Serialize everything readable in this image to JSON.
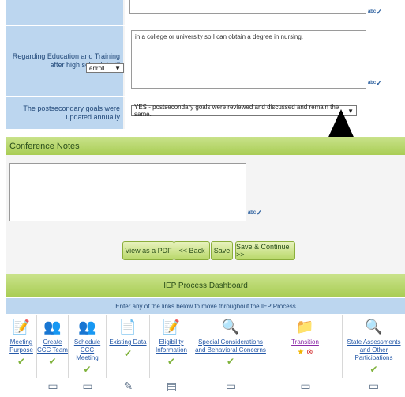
{
  "top_textarea": {
    "value": ""
  },
  "education": {
    "label": "Regarding Education and Training after high school, I will",
    "select_value": "enroll",
    "textarea_value": "in a college or university so I can obtain a degree in nursing."
  },
  "postsecondary": {
    "label": "The postsecondary goals were updated annually",
    "select_value": "YES - postsecondary goals were reviewed and discussed and remain the same."
  },
  "conference_notes": {
    "title": "Conference Notes",
    "value": ""
  },
  "buttons": {
    "pdf": "View as a PDF",
    "back": "<< Back",
    "save": "Save",
    "save_continue": "Save & Continue >>"
  },
  "dashboard": {
    "title": "IEP Process Dashboard",
    "subtitle": "Enter any of the links below to move throughout the IEP Process",
    "tiles": [
      {
        "label": "Meeting Purpose",
        "icon": "document-edit-icon",
        "status": "check"
      },
      {
        "label": "Create CCC Team",
        "icon": "team-icon",
        "status": "check"
      },
      {
        "label": "Schedule CCC Meeting",
        "icon": "team-icon",
        "status": "check"
      },
      {
        "label": "Existing Data",
        "icon": "data-sheet-icon",
        "status": "check"
      },
      {
        "label": "Eligibility Information",
        "icon": "document-edit-icon",
        "status": "check"
      },
      {
        "label": "Special Considerations and Behavioral Concerns",
        "icon": "magnifier-icon",
        "status": "check"
      },
      {
        "label": "Transition",
        "icon": "folder-icon",
        "status": "in-progress"
      },
      {
        "label": "State Assessments and Other Participations",
        "icon": "magnifier-icon",
        "status": "check"
      }
    ]
  },
  "colors": {
    "label_bg": "#bcd6ef",
    "green_bar": "#a9cd55",
    "link": "#2458a8"
  }
}
